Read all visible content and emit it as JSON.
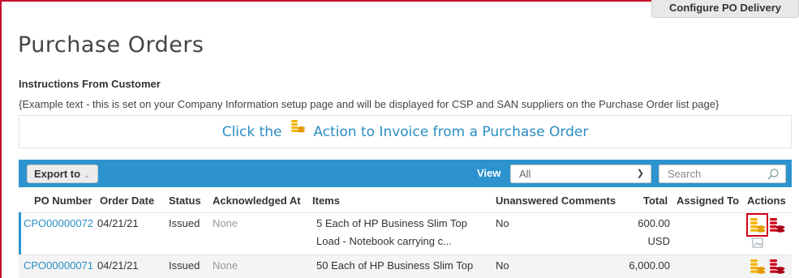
{
  "header": {
    "configure_button": "Configure PO Delivery",
    "page_title": "Purchase Orders"
  },
  "instructions": {
    "heading": "Instructions From Customer",
    "text": "{Example text - this is set on your Company Information setup page and will be displayed for CSP and SAN suppliers on the Purchase Order list page}"
  },
  "banner": {
    "before": "Click the",
    "after": "Action to Invoice from a Purchase Order",
    "coin_icon": "gold-coins-icon"
  },
  "toolbar": {
    "export_label": "Export to",
    "view_label": "View",
    "view_value": "All",
    "search_placeholder": "Search"
  },
  "table": {
    "columns": [
      "PO Number",
      "Order Date",
      "Status",
      "Acknowledged At",
      "Items",
      "Unanswered Comments",
      "Total",
      "Assigned To",
      "Actions"
    ],
    "rows": [
      {
        "po_number": "CPO00000072",
        "order_date": "04/21/21",
        "status": "Issued",
        "acknowledged_at": "None",
        "items_line1": "5 Each of HP Business Slim Top",
        "items_line2": "Load - Notebook carrying c...",
        "unanswered_comments": "No",
        "total": "600.00",
        "currency": "USD",
        "assigned_to": "",
        "actions": [
          "gold-coins-icon",
          "red-coins-icon",
          "attachment-image-icon"
        ]
      },
      {
        "po_number": "CPO00000071",
        "order_date": "04/21/21",
        "status": "Issued",
        "acknowledged_at": "None",
        "items_line1": "50 Each of HP Business Slim Top",
        "unanswered_comments": "No",
        "total": "6,000.00",
        "assigned_to": "",
        "actions": [
          "gold-coins-icon",
          "red-coins-icon"
        ]
      }
    ]
  },
  "colors": {
    "toolbar_bg": "#2d93cf",
    "link": "#2b8ec4",
    "highlight": "#d0021b",
    "coin_gold": "#f5b400",
    "coin_red": "#d0021b"
  }
}
